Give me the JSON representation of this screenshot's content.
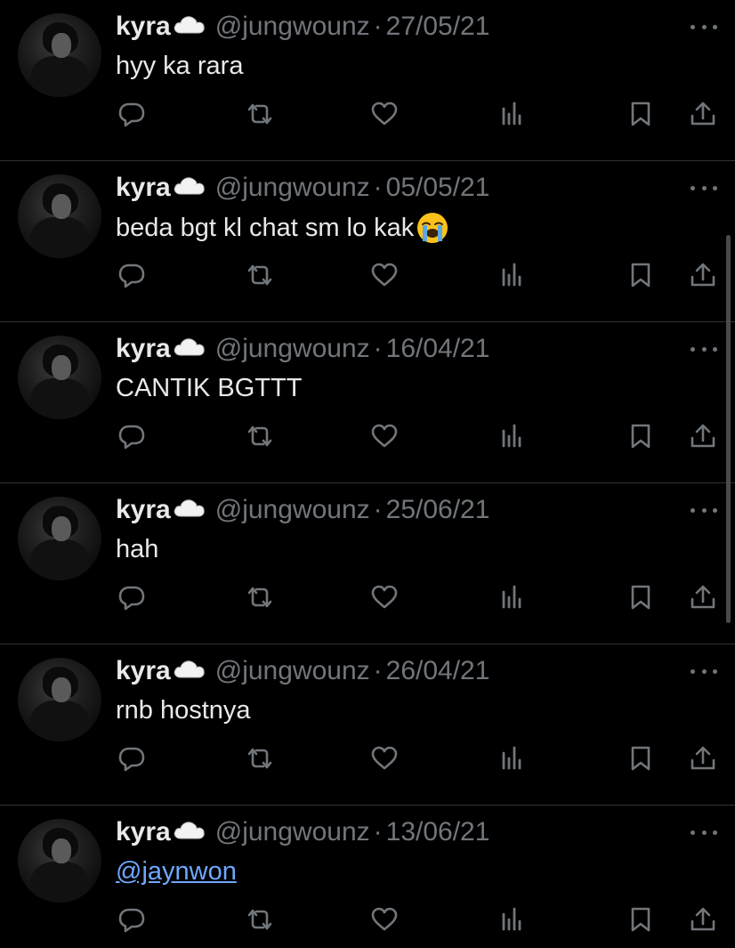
{
  "colors": {
    "background": "#000000",
    "text_primary": "#e7e9ea",
    "text_secondary": "#71767b",
    "divider": "#2f3336",
    "link": "#6ea8fe"
  },
  "icons": {
    "name_suffix": "cloud-icon",
    "more": "more-dots-icon",
    "reply": "reply-bubble-icon",
    "retweet": "retweet-icon",
    "like": "heart-icon",
    "views": "views-bar-chart-icon",
    "bookmark": "bookmark-icon",
    "share": "share-upload-icon"
  },
  "tweets": [
    {
      "name": "kyra",
      "handle": "@jungwounz",
      "separator": "·",
      "date": "27/05/21",
      "text": "hyy ka rara"
    },
    {
      "name": "kyra",
      "handle": "@jungwounz",
      "separator": "·",
      "date": "05/05/21",
      "text": "beda bgt kl chat sm lo kak",
      "emoji": "loudly-crying-face-emoji"
    },
    {
      "name": "kyra",
      "handle": "@jungwounz",
      "separator": "·",
      "date": "16/04/21",
      "text": "CANTIK BGTTT"
    },
    {
      "name": "kyra",
      "handle": "@jungwounz",
      "separator": "·",
      "date": "25/06/21",
      "text": "hah"
    },
    {
      "name": "kyra",
      "handle": "@jungwounz",
      "separator": "·",
      "date": "26/04/21",
      "text": "rnb hostnya"
    },
    {
      "name": "kyra",
      "handle": "@jungwounz",
      "separator": "·",
      "date": "13/06/21",
      "text": "@jaynwon",
      "is_link": true
    }
  ]
}
